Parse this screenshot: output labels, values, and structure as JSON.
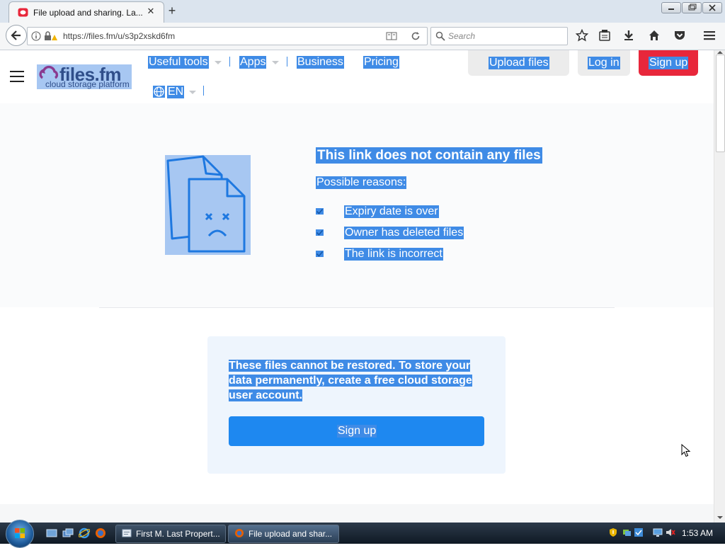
{
  "browser": {
    "tab_title": "File upload and sharing. La...",
    "url": "https://files.fm/u/s3p2xskd6fm",
    "search_placeholder": "Search"
  },
  "header": {
    "logo_main": "files.fm",
    "logo_sub": "cloud storage platform",
    "nav": {
      "useful_tools": "Useful tools",
      "apps": "Apps",
      "business": "Business",
      "pricing": "Pricing",
      "language": "EN"
    },
    "buttons": {
      "upload": "Upload files",
      "login": "Log in",
      "signup": "Sign up"
    },
    "colors": {
      "signup_bg": "#e8273b",
      "selection": "#3f8be6"
    }
  },
  "error": {
    "title": "This link does not contain any files",
    "reasons_label": "Possible reasons:",
    "reasons": [
      "Expiry date is over",
      "Owner has deleted files",
      "The link is incorrect"
    ]
  },
  "restore_card": {
    "text": "These files cannot be restored. To store your data permanently, create a free cloud storage user account.",
    "button": "Sign up",
    "button_color": "#1e88f0"
  },
  "taskbar": {
    "tasks": [
      {
        "label": "First M. Last Propert..."
      },
      {
        "label": "File upload and shar..."
      }
    ],
    "clock": "1:53 AM"
  }
}
